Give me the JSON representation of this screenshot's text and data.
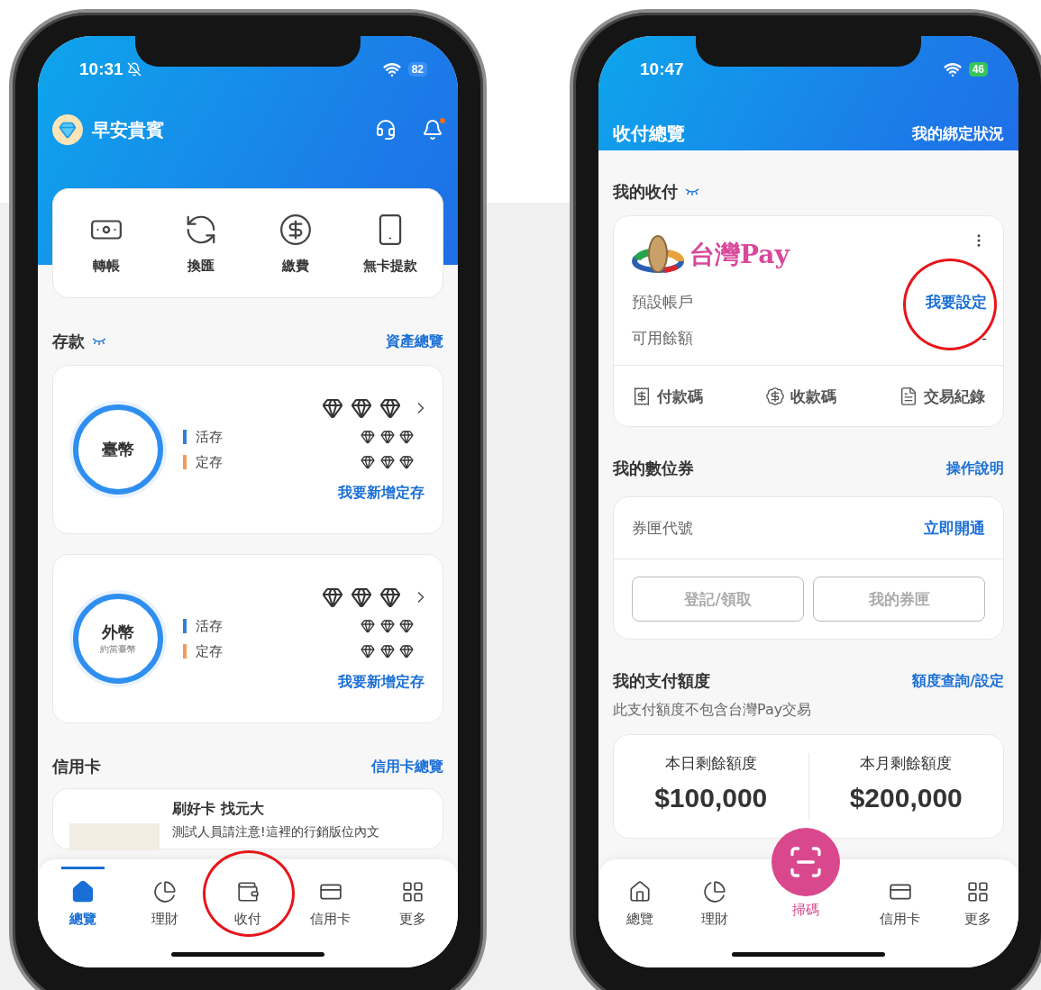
{
  "left_phone": {
    "status_bar": {
      "time": "10:31",
      "battery": "82"
    },
    "greeting": "早安貴賓",
    "quick_actions": [
      "轉帳",
      "換匯",
      "繳費",
      "無卡提款"
    ],
    "deposits": {
      "title": "存款",
      "link": "資產總覽",
      "cards": [
        {
          "currency": "臺幣",
          "rows": [
            "活存",
            "定存"
          ],
          "link": "我要新增定存"
        },
        {
          "currency": "外幣",
          "note": "約當臺幣",
          "rows": [
            "活存",
            "定存"
          ],
          "link": "我要新增定存"
        }
      ]
    },
    "credit_card": {
      "title": "信用卡",
      "link": "信用卡總覽",
      "promo_title": "刷好卡 找元大",
      "promo_text": "測試人員請注意!這裡的行銷版位內文"
    },
    "tabs": [
      {
        "label": "總覽",
        "selected": true
      },
      {
        "label": "理財",
        "selected": false
      },
      {
        "label": "收付",
        "selected": false
      },
      {
        "label": "信用卡",
        "selected": false
      },
      {
        "label": "更多",
        "selected": false
      }
    ]
  },
  "right_phone": {
    "status_bar": {
      "time": "10:47",
      "battery": "46"
    },
    "title": "收付總覽",
    "header_link": "我的綁定狀況",
    "my_payments": {
      "title": "我的收付",
      "logo_text": "台灣Pay",
      "rows": [
        {
          "label": "預設帳戶",
          "value": "我要設定",
          "kind": "link"
        },
        {
          "label": "可用餘額",
          "value": "-",
          "kind": "plain"
        }
      ],
      "actions": [
        "付款碼",
        "收款碼",
        "交易紀錄"
      ]
    },
    "vouchers": {
      "title": "我的數位券",
      "link": "操作說明",
      "field_label": "券匣代號",
      "field_link": "立即開通",
      "buttons": [
        {
          "label": "登記/領取",
          "disabled": true
        },
        {
          "label": "我的券匣",
          "disabled": true
        }
      ]
    },
    "limits": {
      "title": "我的支付額度",
      "link": "額度查詢/設定",
      "note": "此支付額度不包含台灣Pay交易",
      "items": [
        {
          "label": "本日剩餘額度",
          "amount": "$100,000"
        },
        {
          "label": "本月剩餘額度",
          "amount": "$200,000"
        }
      ]
    },
    "tabs": [
      {
        "label": "總覽",
        "kind": "normal",
        "selected": false
      },
      {
        "label": "理財",
        "kind": "normal",
        "selected": false
      },
      {
        "label": "掃碼",
        "kind": "scan",
        "selected": false
      },
      {
        "label": "信用卡",
        "kind": "normal",
        "selected": false
      },
      {
        "label": "更多",
        "kind": "normal",
        "selected": false
      }
    ]
  }
}
